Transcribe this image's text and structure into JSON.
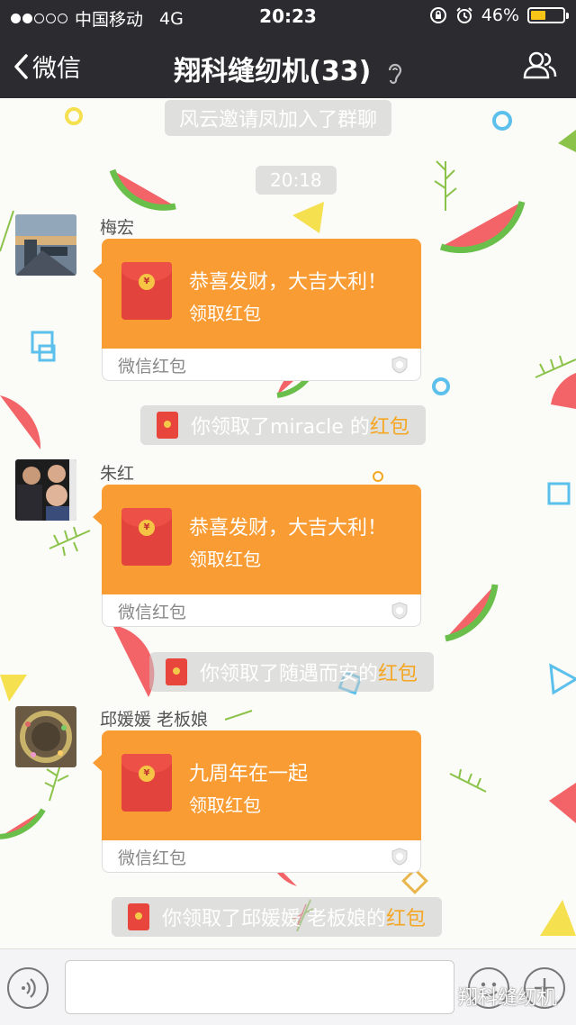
{
  "status": {
    "carrier": "中国移动",
    "network": "4G",
    "time": "20:23",
    "battery": "46%",
    "battery_level": 0.46,
    "signal_bars": 2
  },
  "header": {
    "back_label": "微信",
    "title": "翔科缝纫机(33)"
  },
  "messages": {
    "system_invite": "风云邀请凤加入了群聊",
    "timestamp": "20:18",
    "items": [
      {
        "sender": "梅宏",
        "greeting": "恭喜发财，大吉大利！",
        "action": "领取红包",
        "brand": "微信红包",
        "receipt_prefix": "你领取了",
        "receipt_name": "miracle 的",
        "receipt_suffix": "红包"
      },
      {
        "sender": "朱红",
        "greeting": "恭喜发财，大吉大利！",
        "action": "领取红包",
        "brand": "微信红包",
        "receipt_prefix": "你领取了",
        "receipt_name": "随遇而安的",
        "receipt_suffix": "红包"
      },
      {
        "sender": "邱媛媛 老板娘",
        "greeting": "九周年在一起",
        "action": "领取红包",
        "brand": "微信红包",
        "receipt_prefix": "你领取了",
        "receipt_name": "邱媛媛 老板娘的",
        "receipt_suffix": "红包"
      }
    ]
  },
  "watermark": "翔科缝纫机",
  "colors": {
    "header_bg": "#2c2c30",
    "packet_orange": "#f99c33",
    "envelope_red": "#e3433d",
    "highlight": "#f5a623"
  }
}
